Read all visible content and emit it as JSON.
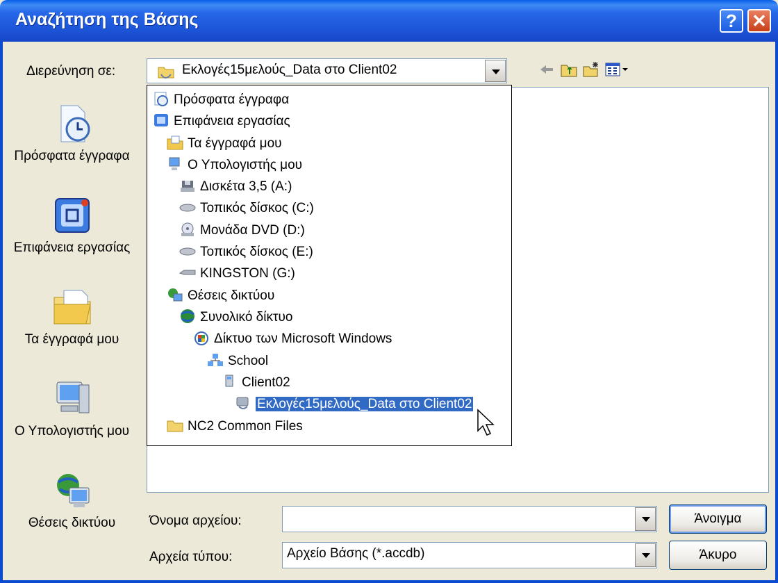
{
  "window": {
    "title": "Αναζήτηση της Βάσης",
    "help_label": "?",
    "close_label": "✕"
  },
  "look_in": {
    "label": "Διερεύνηση σε:",
    "value": "Εκλογές15μελούς_Data στο Client02"
  },
  "toolbar": {
    "back_icon": "back-arrow-icon",
    "up_icon": "up-folder-icon",
    "new_folder_icon": "new-folder-icon",
    "views_icon": "views-menu-icon"
  },
  "places": [
    {
      "label": "Πρόσφατα έγγραφα",
      "icon": "recent-documents-icon"
    },
    {
      "label": "Επιφάνεια εργασίας",
      "icon": "desktop-icon"
    },
    {
      "label": "Τα έγγραφά μου",
      "icon": "my-documents-icon"
    },
    {
      "label": "Ο Υπολογιστής μου",
      "icon": "my-computer-icon"
    },
    {
      "label": "Θέσεις δικτύου",
      "icon": "network-places-icon"
    }
  ],
  "dropdown": {
    "items": [
      {
        "label": "Πρόσφατα έγγραφα",
        "icon": "recent-documents-icon",
        "level": 0
      },
      {
        "label": "Επιφάνεια εργασίας",
        "icon": "desktop-icon",
        "level": 0
      },
      {
        "label": "Τα έγγραφά μου",
        "icon": "my-documents-icon",
        "level": 1
      },
      {
        "label": "Ο Υπολογιστής μου",
        "icon": "my-computer-icon",
        "level": 1
      },
      {
        "label": "Δισκέτα 3,5 (A:)",
        "icon": "floppy-drive-icon",
        "level": 2
      },
      {
        "label": "Τοπικός δίσκος (C:)",
        "icon": "hard-disk-icon",
        "level": 2
      },
      {
        "label": "Μονάδα DVD (D:)",
        "icon": "dvd-drive-icon",
        "level": 2
      },
      {
        "label": "Τοπικός δίσκος (E:)",
        "icon": "hard-disk-icon",
        "level": 2
      },
      {
        "label": "KINGSTON (G:)",
        "icon": "removable-drive-icon",
        "level": 2
      },
      {
        "label": "Θέσεις δικτύου",
        "icon": "network-places-icon",
        "level": 1
      },
      {
        "label": "Συνολικό δίκτυο",
        "icon": "entire-network-icon",
        "level": 2
      },
      {
        "label": "Δίκτυο των Microsoft Windows",
        "icon": "windows-network-icon",
        "level": 3
      },
      {
        "label": "School",
        "icon": "workgroup-icon",
        "level": 4
      },
      {
        "label": "Client02",
        "icon": "computer-icon",
        "level": 5
      },
      {
        "label": "Εκλογές15μελούς_Data στο Client02",
        "icon": "shared-folder-icon",
        "level": 6,
        "selected": true
      },
      {
        "label": "NC2 Common Files",
        "icon": "folder-icon",
        "level": 1
      }
    ]
  },
  "file_name": {
    "label": "Όνομα αρχείου:",
    "value": ""
  },
  "file_type": {
    "label": "Αρχεία τύπου:",
    "value": "Αρχείο Βάσης (*.accdb)"
  },
  "buttons": {
    "open": "Άνοιγμα",
    "cancel": "Άκυρο"
  }
}
